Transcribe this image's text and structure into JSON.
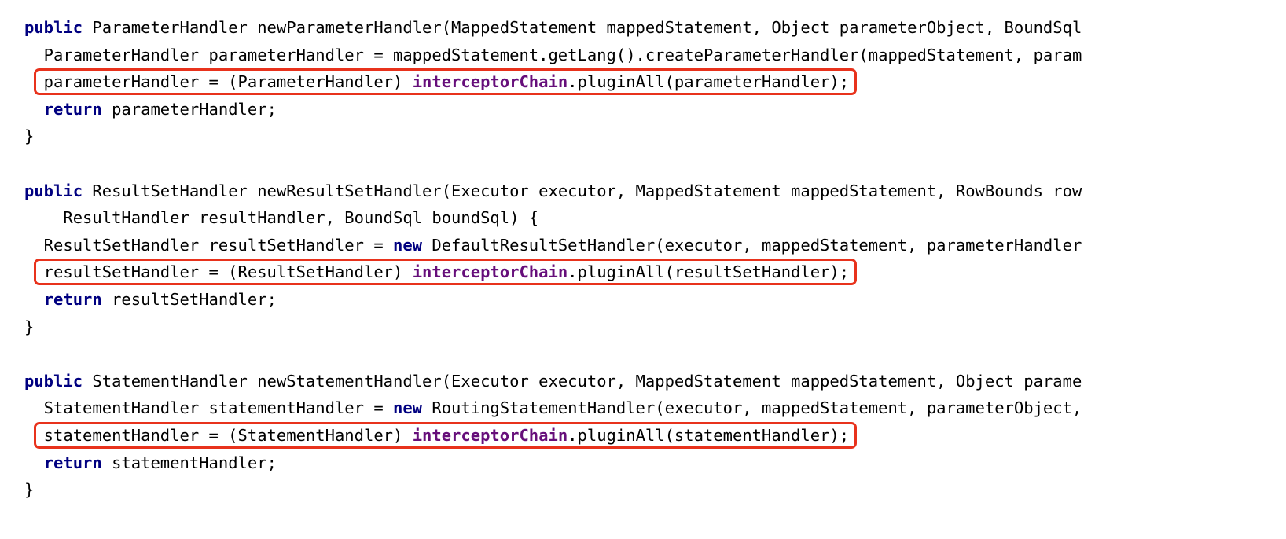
{
  "code": {
    "lines": [
      [
        {
          "t": "public",
          "c": "kw"
        },
        {
          "t": " ParameterHandler newParameterHandler(MappedStatement mappedStatement, Object parameterObject, BoundSql",
          "c": "plain"
        }
      ],
      [
        {
          "t": "  ParameterHandler parameterHandler = mappedStatement.getLang().createParameterHandler(mappedStatement, param",
          "c": "plain"
        }
      ],
      [
        {
          "t": "  parameterHandler = (ParameterHandler) ",
          "c": "plain"
        },
        {
          "t": "interceptorChain",
          "c": "fld"
        },
        {
          "t": ".pluginAll(parameterHandler);",
          "c": "plain"
        }
      ],
      [
        {
          "t": "  ",
          "c": "plain"
        },
        {
          "t": "return",
          "c": "kw"
        },
        {
          "t": " parameterHandler;",
          "c": "plain"
        }
      ],
      [
        {
          "t": "}",
          "c": "plain"
        }
      ],
      [],
      [
        {
          "t": "public",
          "c": "kw"
        },
        {
          "t": " ResultSetHandler newResultSetHandler(Executor executor, MappedStatement mappedStatement, RowBounds row",
          "c": "plain"
        }
      ],
      [
        {
          "t": "    ResultHandler resultHandler, BoundSql boundSql) {",
          "c": "plain"
        }
      ],
      [
        {
          "t": "  ResultSetHandler resultSetHandler = ",
          "c": "plain"
        },
        {
          "t": "new",
          "c": "kw"
        },
        {
          "t": " DefaultResultSetHandler(executor, mappedStatement, parameterHandler",
          "c": "plain"
        }
      ],
      [
        {
          "t": "  resultSetHandler = (ResultSetHandler) ",
          "c": "plain"
        },
        {
          "t": "interceptorChain",
          "c": "fld"
        },
        {
          "t": ".pluginAll(resultSetHandler);",
          "c": "plain"
        }
      ],
      [
        {
          "t": "  ",
          "c": "plain"
        },
        {
          "t": "return",
          "c": "kw"
        },
        {
          "t": " resultSetHandler;",
          "c": "plain"
        }
      ],
      [
        {
          "t": "}",
          "c": "plain"
        }
      ],
      [],
      [
        {
          "t": "public",
          "c": "kw"
        },
        {
          "t": " StatementHandler newStatementHandler(Executor executor, MappedStatement mappedStatement, Object parame",
          "c": "plain"
        }
      ],
      [
        {
          "t": "  StatementHandler statementHandler = ",
          "c": "plain"
        },
        {
          "t": "new",
          "c": "kw"
        },
        {
          "t": " RoutingStatementHandler(executor, mappedStatement, parameterObject,",
          "c": "plain"
        }
      ],
      [
        {
          "t": "  statementHandler = (StatementHandler) ",
          "c": "plain"
        },
        {
          "t": "interceptorChain",
          "c": "fld"
        },
        {
          "t": ".pluginAll(statementHandler);",
          "c": "plain"
        }
      ],
      [
        {
          "t": "  ",
          "c": "plain"
        },
        {
          "t": "return",
          "c": "kw"
        },
        {
          "t": " statementHandler;",
          "c": "plain"
        }
      ],
      [
        {
          "t": "}",
          "c": "plain"
        }
      ]
    ],
    "highlighted_lines": [
      2,
      9,
      15
    ],
    "colors": {
      "keyword": "#000080",
      "field": "#660e7a",
      "text": "#000000",
      "highlight_border": "#e8321c"
    }
  }
}
